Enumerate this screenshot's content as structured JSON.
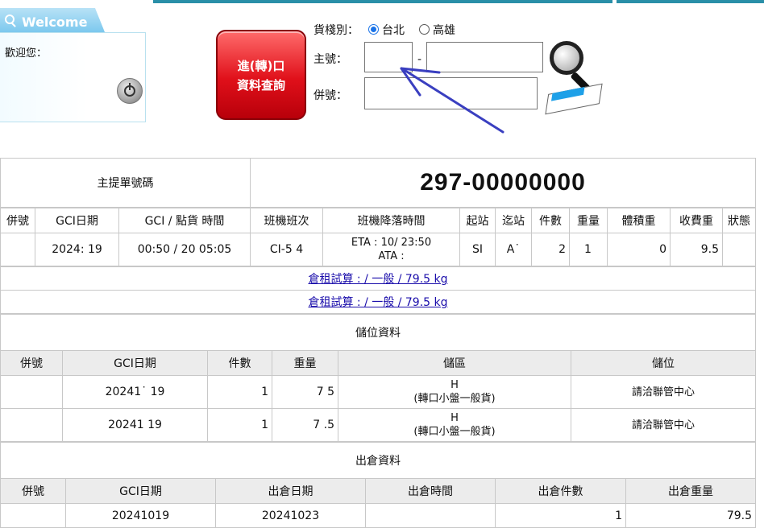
{
  "welcome": {
    "title": "Welcome",
    "greeting": "歡迎您："
  },
  "query_button": {
    "line1": "進(轉)口",
    "line2": "資料查詢"
  },
  "form": {
    "warehouse_label": "貨棧別：",
    "options": [
      {
        "label": "台北",
        "selected": true
      },
      {
        "label": "高雄",
        "selected": false
      }
    ],
    "master_label": "主號：",
    "master_sep": "-",
    "master_prefix": "",
    "master_number": "",
    "house_label": "併號：",
    "house_number": ""
  },
  "mawb": {
    "label": "主提單號碼",
    "value": "297-00000000"
  },
  "flight_table": {
    "headers": [
      "併號",
      "GCI日期",
      "GCI / 點貨 時間",
      "班機班次",
      "班機降落時間",
      "起站",
      "迄站",
      "件數",
      "重量",
      "體積重",
      "收費重",
      "狀態"
    ],
    "row": {
      "house": "",
      "gci_date": "2024:  19",
      "gci_time": "00:50 / 20 05:05",
      "flight": "CI-5    4",
      "eta": "ETA : 10/     23:50",
      "ata": "ATA :",
      "origin": "SI",
      "dest": "A˙",
      "pieces": "2",
      "weight": "1",
      "vol_weight": "0",
      "charge_weight": "9.5",
      "status": ""
    }
  },
  "fee_links": [
    "倉租試算 : / 一般 / 79.5 kg",
    "倉租試算 : / 一般 / 79.5 kg"
  ],
  "storage": {
    "title": "儲位資料",
    "headers": [
      "併號",
      "GCI日期",
      "件數",
      "重量",
      "儲區",
      "儲位"
    ],
    "rows": [
      {
        "house": "",
        "gci_date": "20241˙ 19",
        "pieces": "1",
        "weight": "7   5",
        "zone": "H",
        "zone_note": "(轉口小盤一般貨)",
        "location": "請洽聯管中心"
      },
      {
        "house": "",
        "gci_date": "20241  19",
        "pieces": "1",
        "weight": "7  .5",
        "zone": "H",
        "zone_note": "(轉口小盤一般貨)",
        "location": "請洽聯管中心"
      }
    ]
  },
  "release": {
    "title": "出倉資料",
    "headers": [
      "併號",
      "GCI日期",
      "出倉日期",
      "出倉時間",
      "出倉件數",
      "出倉重量"
    ],
    "rows": [
      {
        "house": "",
        "gci_date": "20241019",
        "out_date": "20241023",
        "out_time": "",
        "pieces": "1",
        "weight": "79.5"
      }
    ]
  },
  "colors": {
    "accent_red": "#e0101a",
    "welcome_blue": "#7cc8ee",
    "link": "#1a0dab",
    "annotation_arrow": "#3a3fc0"
  }
}
